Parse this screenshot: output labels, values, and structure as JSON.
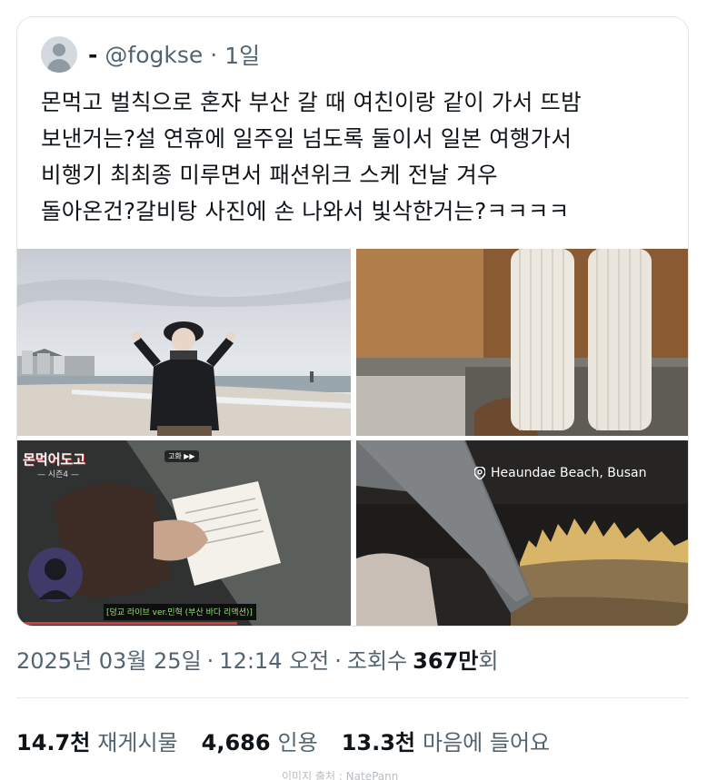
{
  "quoted_tweet": {
    "display_name": "-",
    "handle": "@fogkse",
    "separator": "·",
    "time": "1일",
    "text": "몬먹고 벌칙으로 혼자 부산 갈 때 여친이랑 같이 가서 뜨밤\n보낸거는?설 연휴에 일주일 넘도록 둘이서 일본 여행가서\n비행기 최최종 미루면서 패션위크 스케 전날 겨우\n돌아온건?갈비탕 사진에 손 나와서 빛삭한거는?ㅋㅋㅋㅋ",
    "avatar_icon": "default-avatar-icon"
  },
  "photos": {
    "video_title": "몬먹어도고",
    "video_subtitle": "— 시즌4 —",
    "video_badge": "고화 ▶▶",
    "video_caption": "[덩교 라이브 ver.민혁 (부산 바다 리액션)]",
    "location_label": "Heaundae Beach, Busan",
    "location_icon": "location-pin-icon"
  },
  "meta": {
    "date": "2025년 03월 25일",
    "dot1": "·",
    "time": "12:14 오전",
    "dot2": "·",
    "views_label": "조회수",
    "views_value": "367만",
    "views_unit": "회"
  },
  "stats": {
    "retweets_value": "14.7천",
    "retweets_label": "재게시물",
    "quotes_value": "4,686",
    "quotes_label": "인용",
    "likes_value": "13.3천",
    "likes_label": "마음에 들어요"
  },
  "source_credit": "이미지 출처 : NatePann"
}
